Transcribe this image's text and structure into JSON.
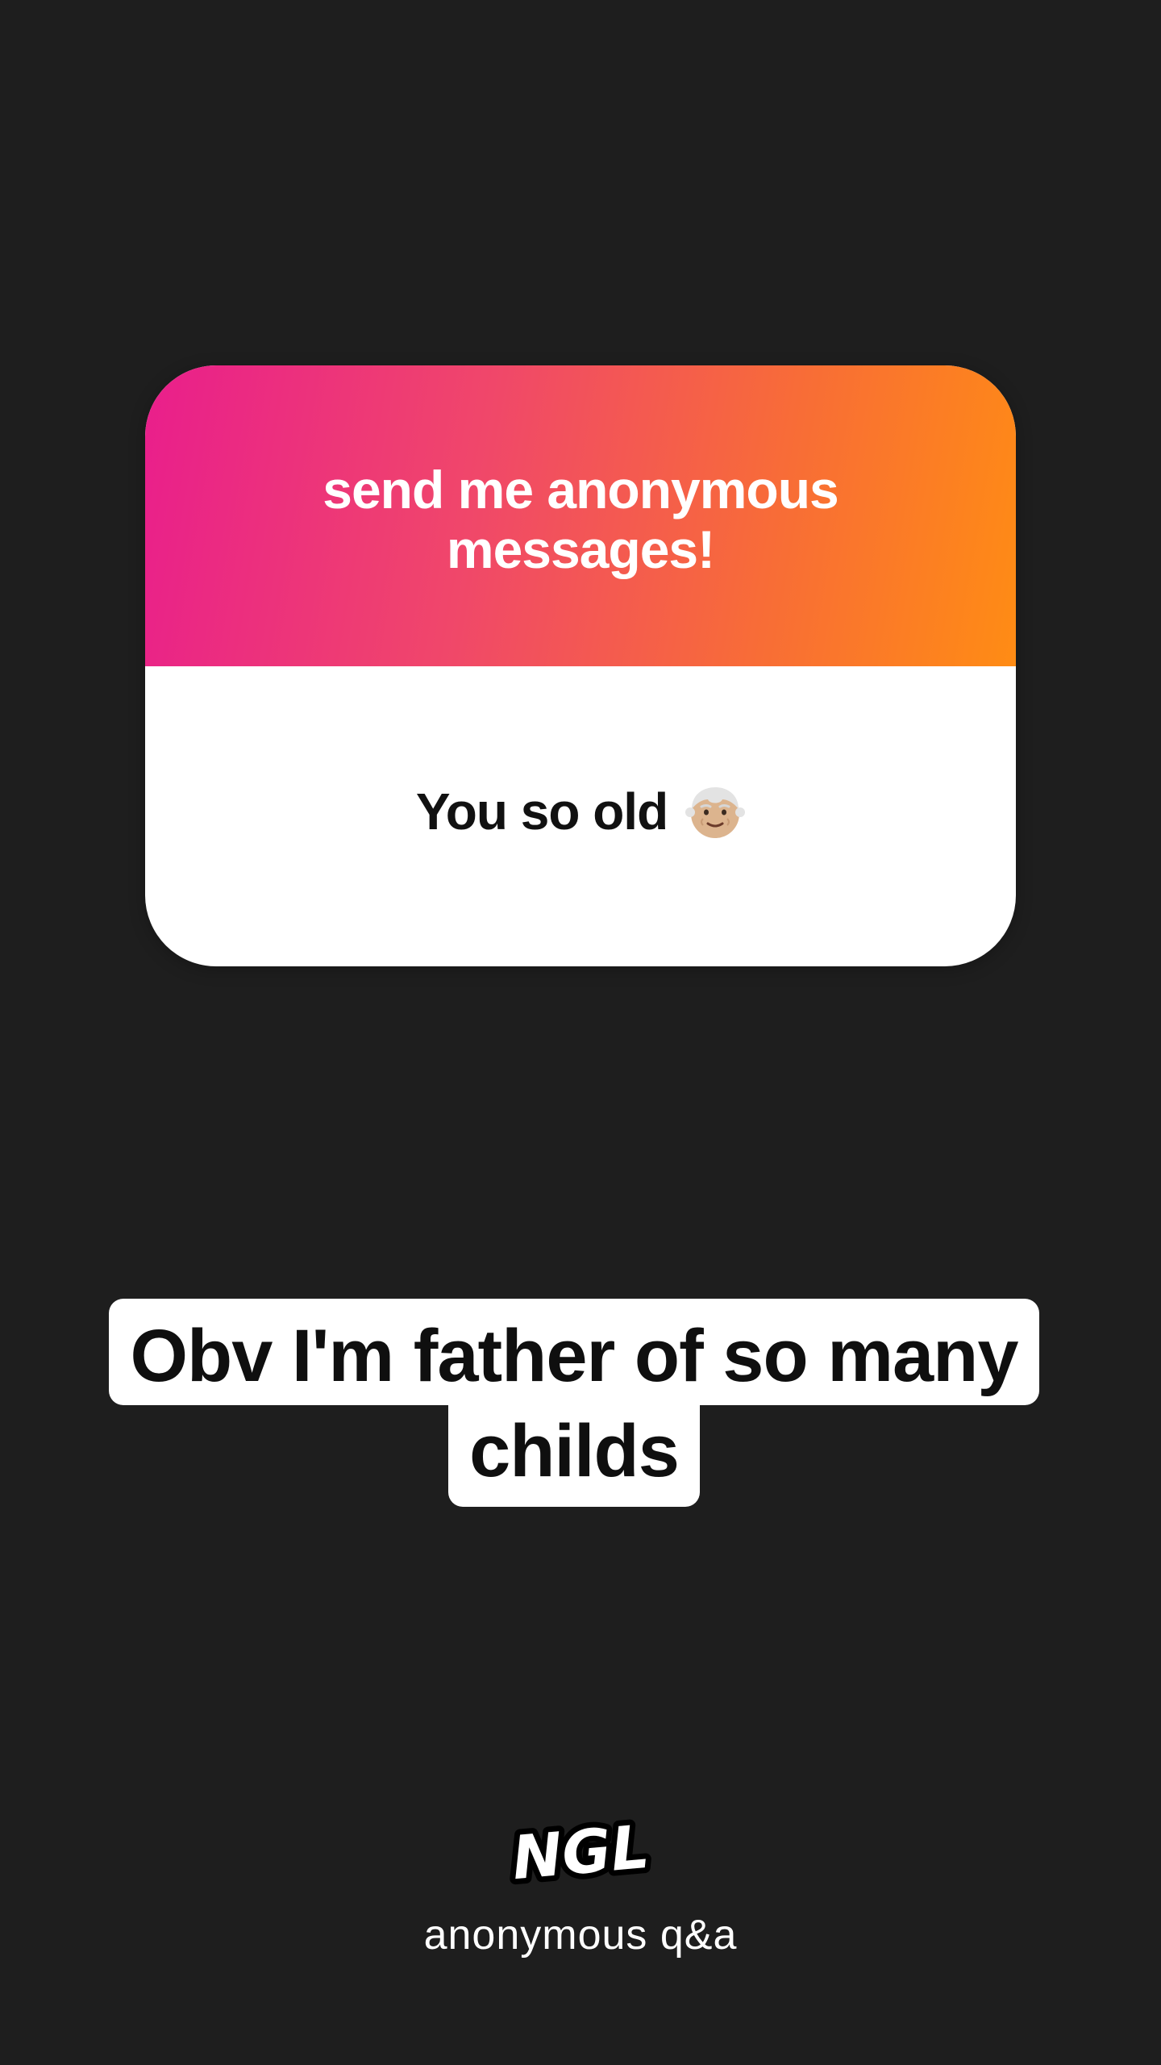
{
  "card": {
    "header": "send me anonymous messages!",
    "message": "You so old",
    "message_emoji": "older-person-emoji-icon"
  },
  "reply": {
    "line1": "Obv I'm father of so many",
    "line2": "childs"
  },
  "brand": {
    "logo": "NGL",
    "tagline": "anonymous q&a"
  },
  "colors": {
    "background": "#1e1e1e",
    "gradient_start": "#e91e8c",
    "gradient_end": "#ff8c14",
    "card_body": "#ffffff",
    "text_dark": "#111111",
    "text_light": "#ffffff"
  }
}
